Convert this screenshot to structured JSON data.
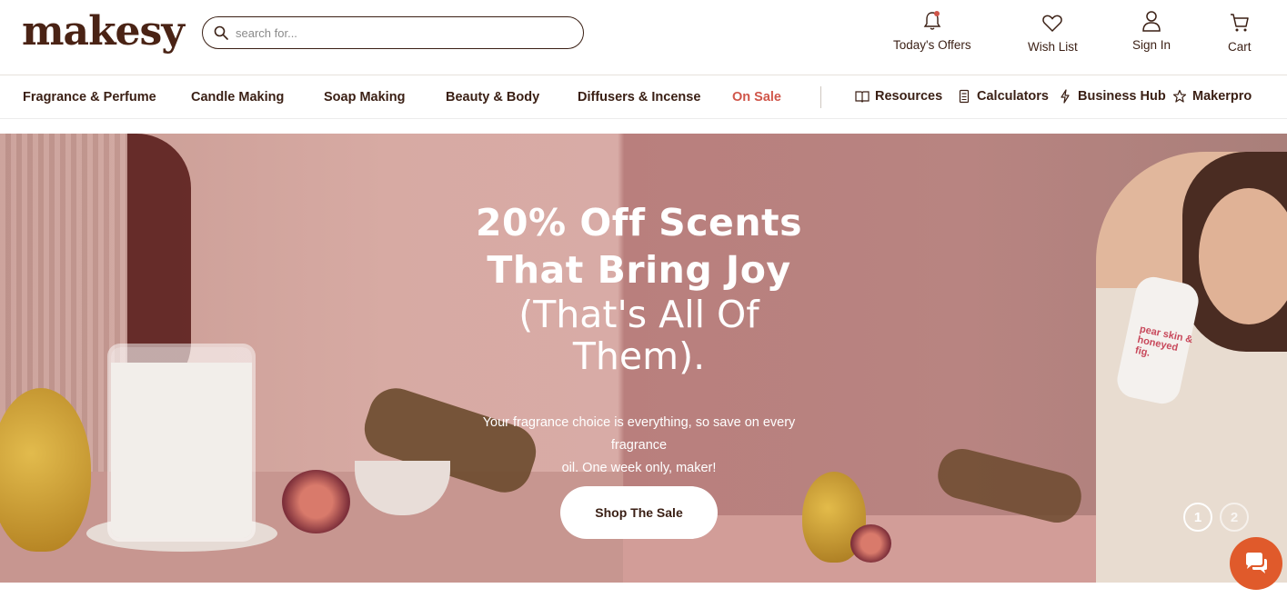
{
  "brand": {
    "logo": "makesy"
  },
  "search": {
    "placeholder": "search for..."
  },
  "header_links": {
    "offers": "Today's Offers",
    "wishlist": "Wish List",
    "signin": "Sign In",
    "cart": "Cart"
  },
  "nav": {
    "categories": [
      "Fragrance & Perfume",
      "Candle Making",
      "Soap Making",
      "Beauty & Body",
      "Diffusers & Incense",
      "On Sale"
    ],
    "utilities": [
      "Resources",
      "Calculators",
      "Business Hub",
      "Makerpro"
    ]
  },
  "hero": {
    "headline_bold_1": "20% Off Scents",
    "headline_bold_2": "That Bring Joy",
    "headline_light_1": "(That's All Of",
    "headline_light_2": "Them).",
    "subtext_1": "Your fragrance choice is everything, so save on every fragrance",
    "subtext_2": "oil. One week only, maker!",
    "cta": "Shop The Sale",
    "bottle_label": "pear skin & honeyed fig.",
    "slides": [
      "1",
      "2"
    ],
    "active_slide": 1
  },
  "colors": {
    "brand_dark": "#3a1f14",
    "sale_red": "#d0564a",
    "chat_orange": "#e05a2b"
  },
  "icons": [
    "search-icon",
    "bell-icon",
    "heart-icon",
    "user-icon",
    "cart-icon",
    "book-icon",
    "calculator-icon",
    "lightning-icon",
    "star-icon",
    "chat-icon"
  ]
}
